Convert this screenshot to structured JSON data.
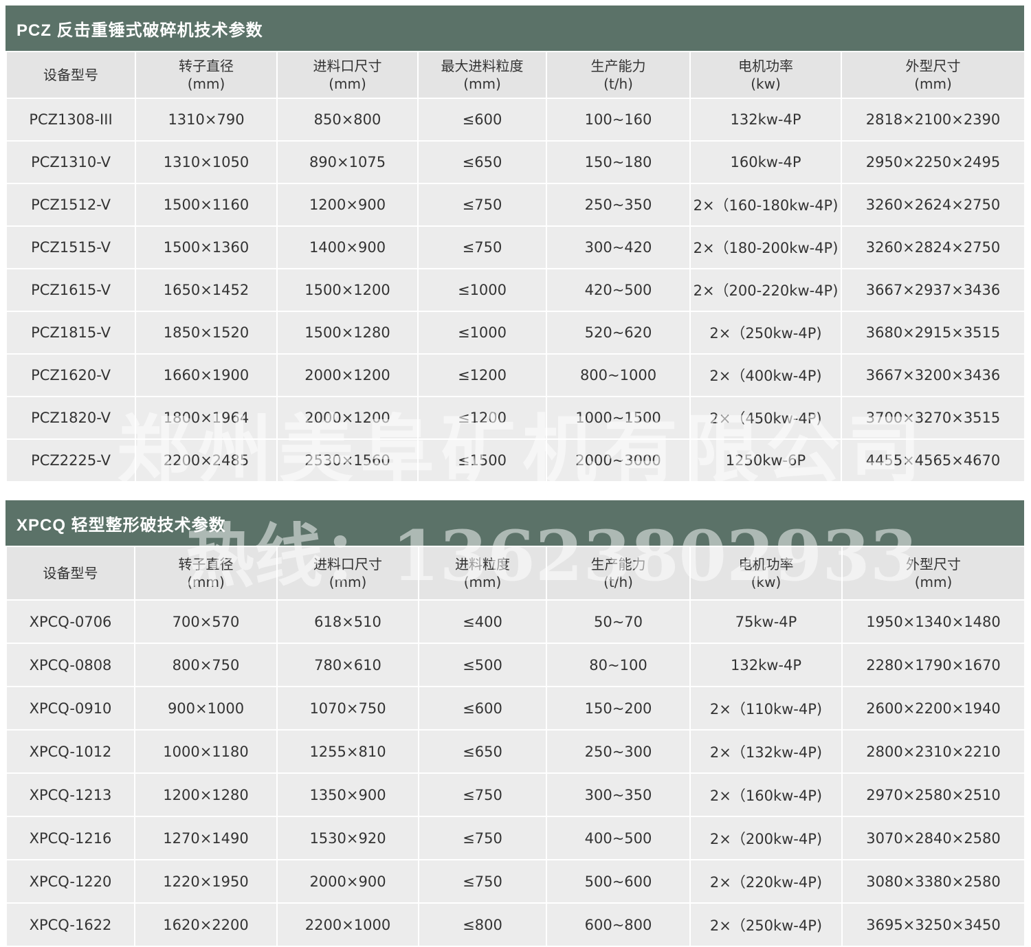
{
  "section1": {
    "title": "PCZ 反击重锤式破碎机技术参数",
    "columns": [
      {
        "name": "设备型号",
        "unit": ""
      },
      {
        "name": "转子直径",
        "unit": "(mm)"
      },
      {
        "name": "进料口尺寸",
        "unit": "(mm)"
      },
      {
        "name": "最大进料粒度",
        "unit": "(mm)"
      },
      {
        "name": "生产能力",
        "unit": "(t/h)"
      },
      {
        "name": "电机功率",
        "unit": "(kw)"
      },
      {
        "name": "外型尺寸",
        "unit": "(mm)"
      }
    ],
    "rows": [
      [
        "PCZ1308-III",
        "1310×790",
        "850×800",
        "≤600",
        "100~160",
        "132kw-4P",
        "2818×2100×2390"
      ],
      [
        "PCZ1310-V",
        "1310×1050",
        "890×1075",
        "≤650",
        "150~180",
        "160kw-4P",
        "2950×2250×2495"
      ],
      [
        "PCZ1512-V",
        "1500×1160",
        "1200×900",
        "≤750",
        "250~350",
        "2×（160-180kw-4P)",
        "3260×2624×2750"
      ],
      [
        "PCZ1515-V",
        "1500×1360",
        "1400×900",
        "≤750",
        "300~420",
        "2×（180-200kw-4P)",
        "3260×2824×2750"
      ],
      [
        "PCZ1615-V",
        "1650×1452",
        "1500×1200",
        "≤1000",
        "420~500",
        "2×（200-220kw-4P)",
        "3667×2937×3436"
      ],
      [
        "PCZ1815-V",
        "1850×1520",
        "1500×1280",
        "≤1000",
        "520~620",
        "2×（250kw-4P)",
        "3680×2915×3515"
      ],
      [
        "PCZ1620-V",
        "1660×1900",
        "2000×1200",
        "≤1200",
        "800~1000",
        "2×（400kw-4P)",
        "3667×3200×3436"
      ],
      [
        "PCZ1820-V",
        "1800×1964",
        "2000×1200",
        "≤1200",
        "1000~1500",
        "2×（450kw-4P)",
        "3700×3270×3515"
      ],
      [
        "PCZ2225-V",
        "2200×2485",
        "2530×1560",
        "≤1500",
        "2000~3000",
        "1250kw-6P",
        "4455×4565×4670"
      ]
    ]
  },
  "section2": {
    "title": "XPCQ 轻型整形破技术参数",
    "columns": [
      {
        "name": "设备型号",
        "unit": ""
      },
      {
        "name": "转子直径",
        "unit": "(mm)"
      },
      {
        "name": "进料口尺寸",
        "unit": "(mm)"
      },
      {
        "name": "进料粒度",
        "unit": "(mm)"
      },
      {
        "name": "生产能力",
        "unit": "(t/h)"
      },
      {
        "name": "电机功率",
        "unit": "(kw)"
      },
      {
        "name": "外型尺寸",
        "unit": "(mm)"
      }
    ],
    "rows": [
      [
        "XPCQ-0706",
        "700×570",
        "618×510",
        "≤400",
        "50~70",
        "75kw-4P",
        "1950×1340×1480"
      ],
      [
        "XPCQ-0808",
        "800×750",
        "780×610",
        "≤500",
        "80~100",
        "132kw-4P",
        "2280×1790×1670"
      ],
      [
        "XPCQ-0910",
        "900×1000",
        "1070×750",
        "≤600",
        "150~200",
        "2×（110kw-4P)",
        "2600×2200×1940"
      ],
      [
        "XPCQ-1012",
        "1000×1180",
        "1255×810",
        "≤650",
        "250~300",
        "2×（132kw-4P)",
        "2800×2310×2210"
      ],
      [
        "XPCQ-1213",
        "1200×1280",
        "1350×900",
        "≤750",
        "300~350",
        "2×（160kw-4P)",
        "2970×2580×2510"
      ],
      [
        "XPCQ-1216",
        "1270×1490",
        "1530×920",
        "≤750",
        "400~500",
        "2×（200kw-4P)",
        "3070×2840×2580"
      ],
      [
        "XPCQ-1220",
        "1220×1950",
        "2000×900",
        "≤750",
        "500~600",
        "2×（220kw-4P)",
        "3080×3380×2580"
      ],
      [
        "XPCQ-1622",
        "1620×2200",
        "2200×1000",
        "≤800",
        "600~800",
        "2×（250kw-4P)",
        "3695×3250×3450"
      ]
    ]
  },
  "watermark": {
    "company": "郑州美阜矿机有限公司",
    "hotline": "热线：13623802933"
  },
  "colors": {
    "title_bar": "#5b7268",
    "cell_background": "#ececec",
    "grid_line": "#ffffff",
    "text": "#333333"
  }
}
